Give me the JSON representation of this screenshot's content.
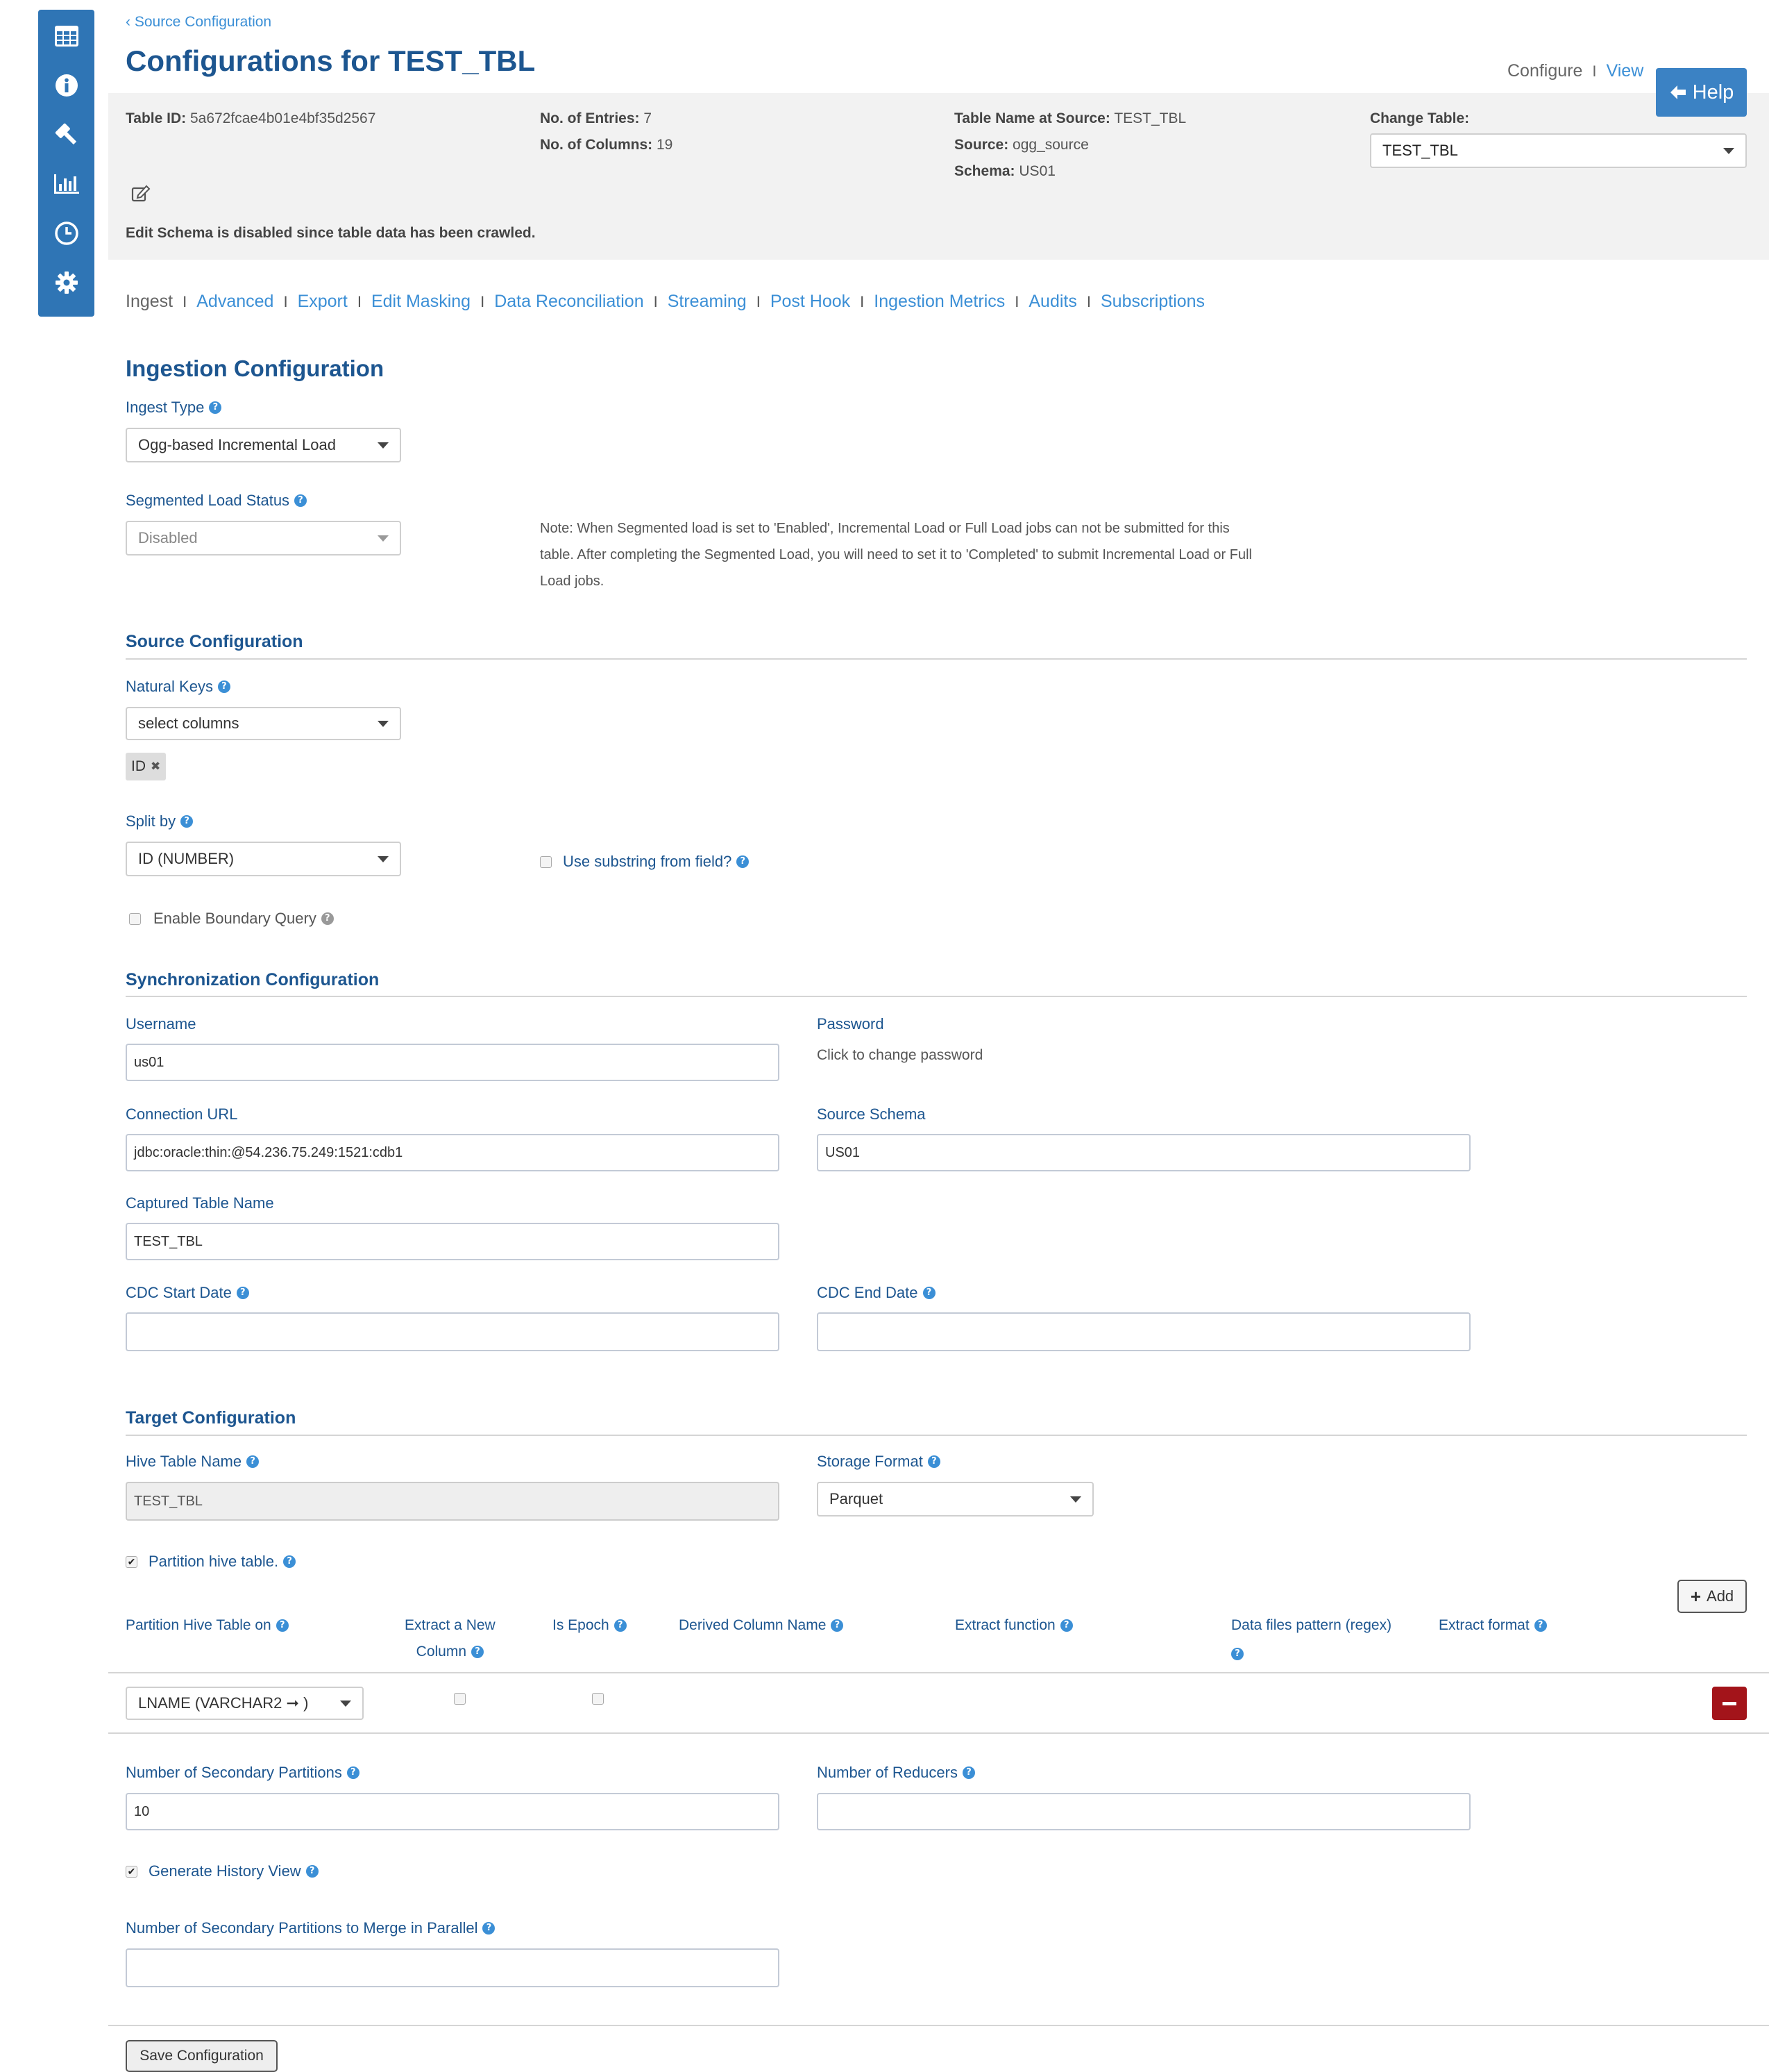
{
  "breadcrumb": "Source Configuration",
  "page_title": "Configurations for TEST_TBL",
  "top_links": {
    "configure": "Configure",
    "separator": "I",
    "view": "View"
  },
  "help_button": "Help",
  "meta": {
    "table_id_label": "Table ID:",
    "table_id": "5a672fcae4b01e4bf35d2567",
    "entries_label": "No. of Entries:",
    "entries": "7",
    "columns_label": "No. of Columns:",
    "columns": "19",
    "source_name_label": "Table Name at Source:",
    "source_name": "TEST_TBL",
    "source_label": "Source:",
    "source": "ogg_source",
    "schema_label": "Schema:",
    "schema": "US01",
    "change_table_label": "Change Table:",
    "change_table": "TEST_TBL",
    "edit_note": "Edit Schema is disabled since table data has been crawled."
  },
  "tabs": [
    "Ingest",
    "Advanced",
    "Export",
    "Edit Masking",
    "Data Reconciliation",
    "Streaming",
    "Post Hook",
    "Ingestion Metrics",
    "Audits",
    "Subscriptions"
  ],
  "tab_separator": "I",
  "ingestion": {
    "title": "Ingestion Configuration",
    "ingest_type_label": "Ingest Type",
    "ingest_type": "Ogg-based Incremental Load",
    "segmented_label": "Segmented Load Status",
    "segmented": "Disabled",
    "note_line1": "Note: When Segmented load is set to 'Enabled', Incremental Load or Full Load jobs can not be submitted for this",
    "note_line2": "table. After completing the Segmented Load, you will need to set it to 'Completed' to submit Incremental Load or Full",
    "note_line3": "Load jobs."
  },
  "source_config": {
    "title": "Source Configuration",
    "natural_keys_label": "Natural Keys",
    "natural_keys_placeholder": "select columns",
    "key_tag": "ID",
    "split_by_label": "Split by",
    "split_by": "ID (NUMBER)",
    "substring_label": "Use substring from field?",
    "boundary_label": "Enable Boundary Query"
  },
  "sync": {
    "title": "Synchronization Configuration",
    "username_label": "Username",
    "username": "us01",
    "password_label": "Password",
    "password_hint": "Click to change password",
    "url_label": "Connection URL",
    "url": "jdbc:oracle:thin:@54.236.75.249:1521:cdb1",
    "schema_label": "Source Schema",
    "schema": "US01",
    "captured_label": "Captured Table Name",
    "captured": "TEST_TBL",
    "cdc_start_label": "CDC Start Date",
    "cdc_start": "",
    "cdc_end_label": "CDC End Date",
    "cdc_end": ""
  },
  "target": {
    "title": "Target Configuration",
    "hive_label": "Hive Table Name",
    "hive": "TEST_TBL",
    "storage_label": "Storage Format",
    "storage": "Parquet",
    "partition_label": "Partition hive table.",
    "add_button": "Add",
    "headers": {
      "partition_on": "Partition Hive Table on",
      "extract_new_1": "Extract a New",
      "extract_new_2": "Column",
      "is_epoch": "Is Epoch",
      "derived": "Derived Column Name",
      "extract_fn": "Extract function",
      "pattern": "Data files pattern (regex)",
      "extract_format": "Extract format"
    },
    "row_column": "LNAME (VARCHAR2 ➞ )",
    "secondary_label": "Number of Secondary Partitions",
    "secondary": "10",
    "reducers_label": "Number of Reducers",
    "reducers": "",
    "history_label": "Generate History View",
    "merge_label": "Number of Secondary Partitions to Merge in Parallel",
    "merge": ""
  },
  "save_button": "Save Configuration",
  "colors": {
    "sidebar": "#2f75b5",
    "title": "#1d5690",
    "link": "#3b8fd6",
    "help": "#3b82c4",
    "remove": "#a3141a"
  }
}
